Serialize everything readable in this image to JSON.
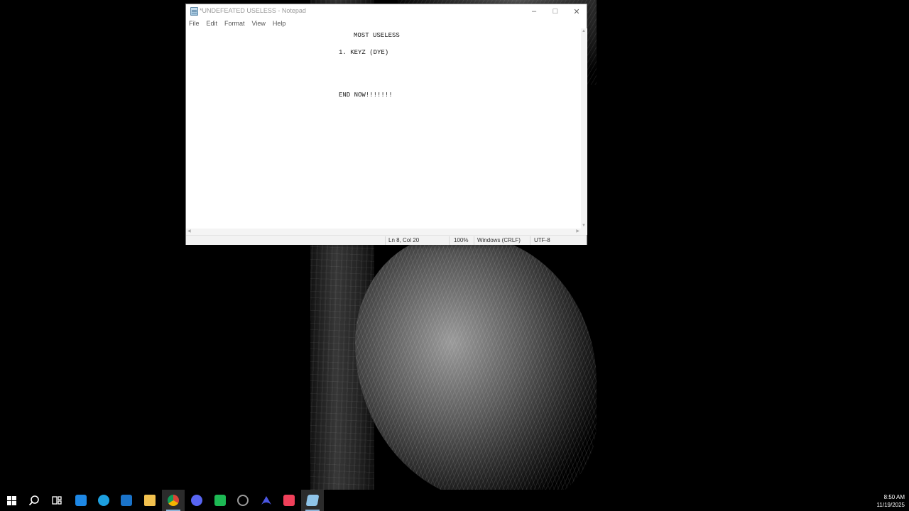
{
  "window": {
    "title": "*UNDEFEATED USELESS - Notepad",
    "controls": {
      "minimize": "–",
      "maximize": "□",
      "close": "✕"
    }
  },
  "menu": [
    "File",
    "Edit",
    "Format",
    "View",
    "Help"
  ],
  "editor": {
    "lines": [
      "MOST USELESS",
      "1. KEYZ (DYE)",
      "END NOW!!!!!!!"
    ]
  },
  "status": {
    "position": "Ln 8, Col 20",
    "zoom": "100%",
    "line_ending": "Windows (CRLF)",
    "encoding": "UTF-8"
  },
  "taskbar": {
    "items": [
      {
        "name": "start",
        "icon": "windows-logo-icon"
      },
      {
        "name": "search",
        "icon": "search-icon"
      },
      {
        "name": "task-view",
        "icon": "task-view-icon"
      },
      {
        "name": "microsoft-store",
        "icon": "store-icon",
        "color": "#1e88e5"
      },
      {
        "name": "edge",
        "icon": "edge-icon",
        "color": "#1da0e0"
      },
      {
        "name": "mail",
        "icon": "mail-icon",
        "color": "#1a73c9"
      },
      {
        "name": "file-explorer",
        "icon": "folder-icon",
        "color": "#f2c14e"
      },
      {
        "name": "chrome",
        "icon": "chrome-icon",
        "color": "#db4437"
      },
      {
        "name": "discord",
        "icon": "discord-icon",
        "color": "#5865f2"
      },
      {
        "name": "app-green",
        "icon": "green-app-icon",
        "color": "#1db954"
      },
      {
        "name": "app-gray",
        "icon": "circle-app-icon",
        "color": "#9a9a9a"
      },
      {
        "name": "app-nav",
        "icon": "nav-app-icon",
        "color": "#4a56e2"
      },
      {
        "name": "itunes",
        "icon": "music-icon",
        "color": "#f0405a"
      },
      {
        "name": "notepad",
        "icon": "notepad-icon",
        "color": "#8fc4e8"
      }
    ],
    "clock": {
      "time": "8:50 AM",
      "date": "11/19/2025"
    }
  }
}
